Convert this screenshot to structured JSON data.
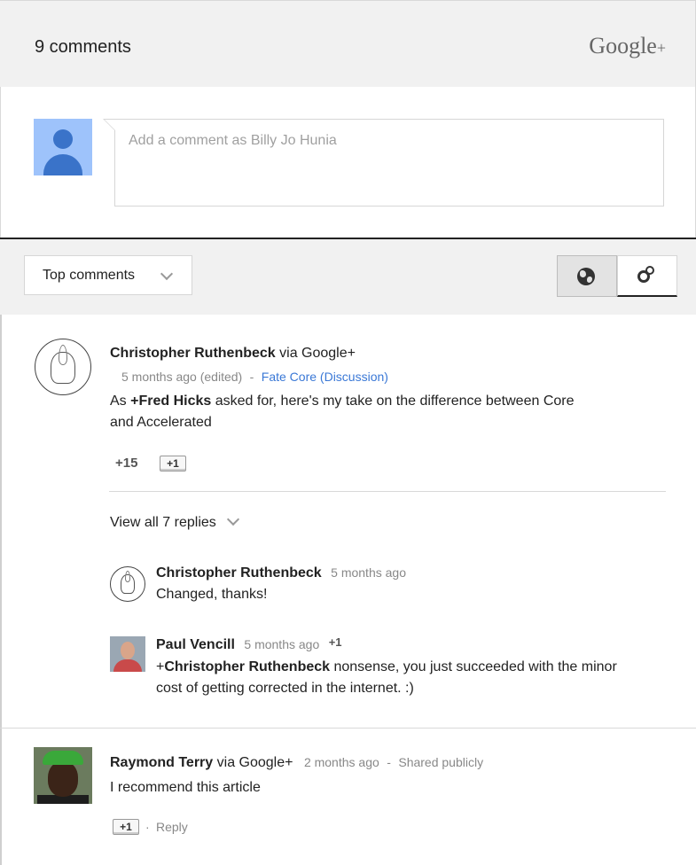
{
  "header": {
    "count": "9 comments",
    "brand": "Google",
    "brand_plus": "+"
  },
  "composer": {
    "placeholder": "Add a comment as Billy Jo Hunia"
  },
  "toolbar": {
    "sort_label": "Top comments"
  },
  "comments": [
    {
      "author": "Christopher Ruthenbeck",
      "via": "via Google+",
      "meta": "5 months ago (edited)",
      "dot": "-",
      "community": "Fate Core (Discussion)",
      "body_pre": "As ",
      "body_mention": "+Fred Hicks",
      "body_post_line1": " asked for, here's my take on the difference between Core",
      "body_line2": "and Accelerated",
      "plus_count": "+15",
      "plus_button": "+1",
      "view_replies": "View all 7 replies",
      "replies": [
        {
          "author": "Christopher Ruthenbeck",
          "time": "5 months ago",
          "text": "Changed, thanks!"
        },
        {
          "author": "Paul Vencill",
          "time": "5 months ago",
          "plus": "+1",
          "text_pre": "+",
          "text_mention": "Christopher Ruthenbeck",
          "text_post_line1": " nonsense, you just succeeded with the minor",
          "text_line2": "cost of getting corrected in the internet. :)"
        }
      ]
    },
    {
      "author": "Raymond Terry",
      "via": "via Google+",
      "time": "2 months ago",
      "dot": "-",
      "visibility": "Shared publicly",
      "body": "I recommend this article",
      "plus_button": "+1",
      "reply_sep": "·",
      "reply": "Reply"
    }
  ]
}
